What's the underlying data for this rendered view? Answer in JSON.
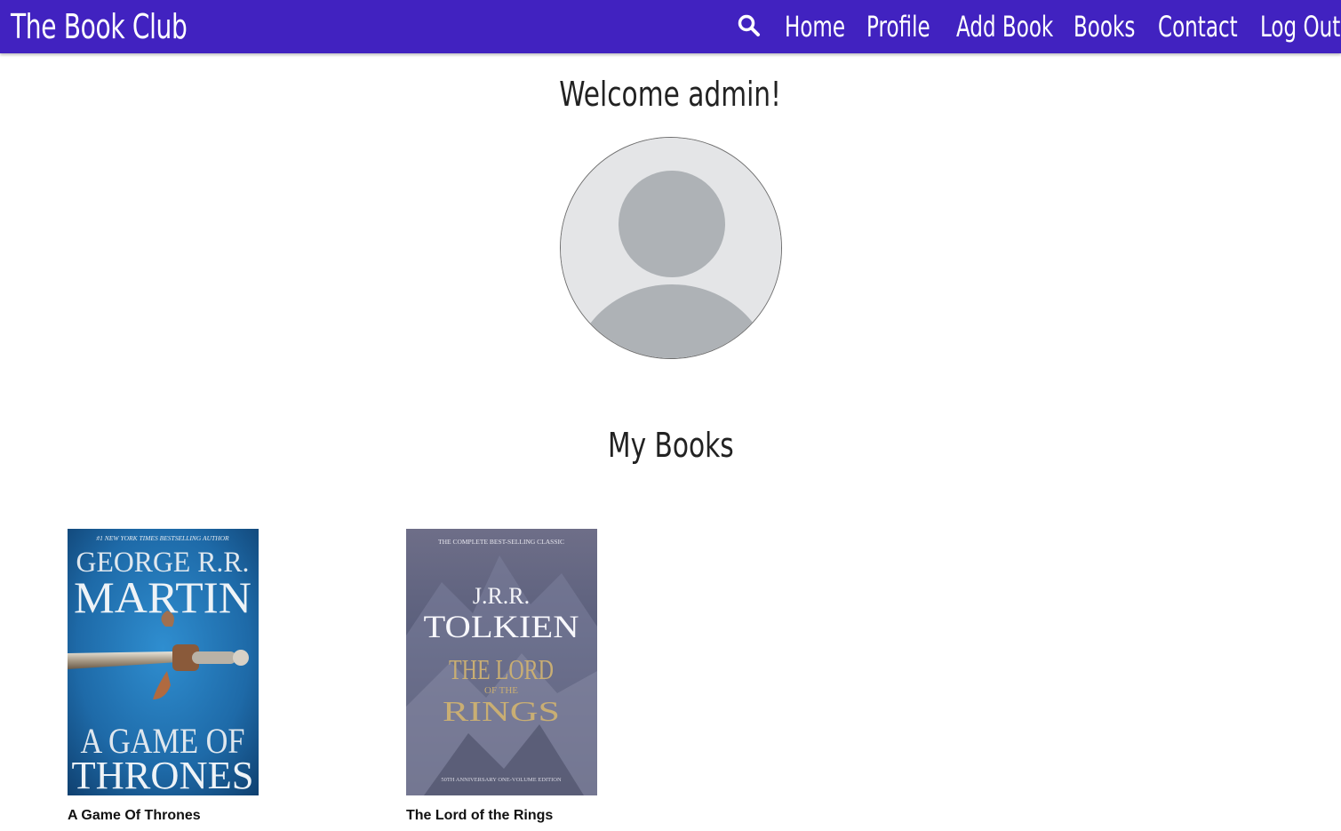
{
  "navbar": {
    "brand": "The Book Club",
    "links": [
      "Home",
      "Profile",
      "Add Book",
      "Books",
      "Contact",
      "Log Out"
    ],
    "search_icon": "search-icon"
  },
  "profile": {
    "welcome": "Welcome admin!",
    "avatar_icon": "default-user-avatar"
  },
  "books_section": {
    "heading": "My Books",
    "books": [
      {
        "title": "A Game Of Thrones",
        "cover": {
          "tagline": "#1 NEW YORK TIMES BESTSELLING AUTHOR",
          "author_first": "GEORGE R.R.",
          "author_last": "MARTIN",
          "title_top": "A GAME OF",
          "title_bottom": "THRONES"
        }
      },
      {
        "title": "The Lord of the Rings",
        "cover": {
          "tagline": "THE COMPLETE BEST-SELLING CLASSIC",
          "author_first": "J.R.R.",
          "author_last": "TOLKIEN",
          "title_top": "THE LORD",
          "title_mid": "OF THE",
          "title_bottom": "RINGS",
          "footer": "50TH ANNIVERSARY ONE-VOLUME EDITION"
        }
      }
    ]
  },
  "colors": {
    "navbar": "#4122c0",
    "avatar_bg": "#e4e5e7",
    "avatar_figure": "#aeb2b6"
  }
}
